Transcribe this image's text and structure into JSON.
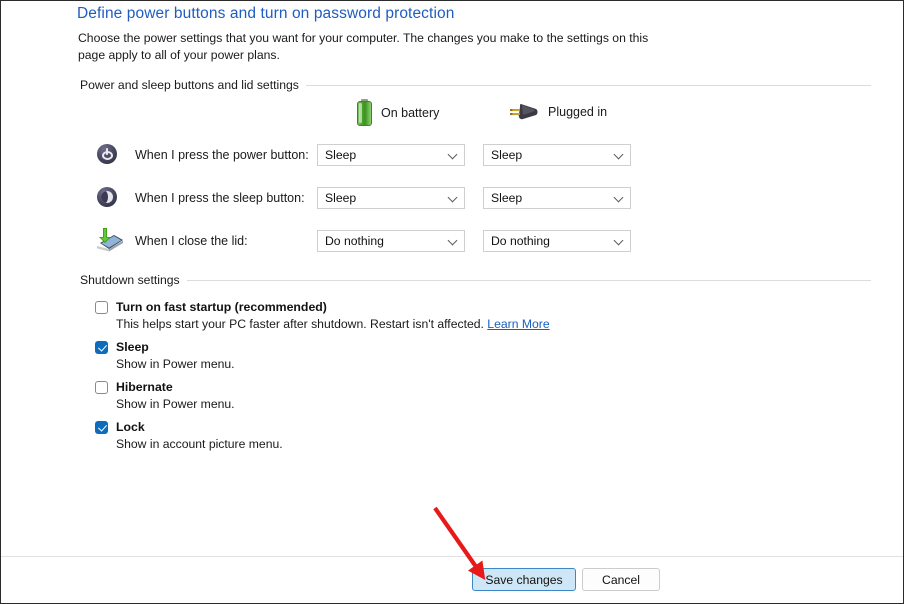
{
  "page": {
    "title": "Define power buttons and turn on password protection",
    "description": "Choose the power settings that you want for your computer. The changes you make to the settings on this page apply to all of your power plans.",
    "title_color": "#1f5dbf"
  },
  "power_section": {
    "group_label": "Power and sleep buttons and lid settings",
    "columns": [
      {
        "label": "On battery",
        "icon": "battery-icon"
      },
      {
        "label": "Plugged in",
        "icon": "plug-icon"
      }
    ],
    "rows": [
      {
        "icon": "power-button-icon",
        "label": "When I press the power button:",
        "on_battery": "Sleep",
        "plugged_in": "Sleep"
      },
      {
        "icon": "sleep-button-icon",
        "label": "When I press the sleep button:",
        "on_battery": "Sleep",
        "plugged_in": "Sleep"
      },
      {
        "icon": "close-lid-icon",
        "label": "When I close the lid:",
        "on_battery": "Do nothing",
        "plugged_in": "Do nothing"
      }
    ]
  },
  "shutdown_section": {
    "group_label": "Shutdown settings",
    "items": [
      {
        "label": "Turn on fast startup (recommended)",
        "checked": false,
        "description": "This helps start your PC faster after shutdown. Restart isn't affected.",
        "link": "Learn More"
      },
      {
        "label": "Sleep",
        "checked": true,
        "description": "Show in Power menu.",
        "link": ""
      },
      {
        "label": "Hibernate",
        "checked": false,
        "description": "Show in Power menu.",
        "link": ""
      },
      {
        "label": "Lock",
        "checked": true,
        "description": "Show in account picture menu.",
        "link": ""
      }
    ]
  },
  "footer": {
    "save_label": "Save changes",
    "cancel_label": "Cancel"
  },
  "annotation": {
    "arrow_color": "#e81919"
  }
}
